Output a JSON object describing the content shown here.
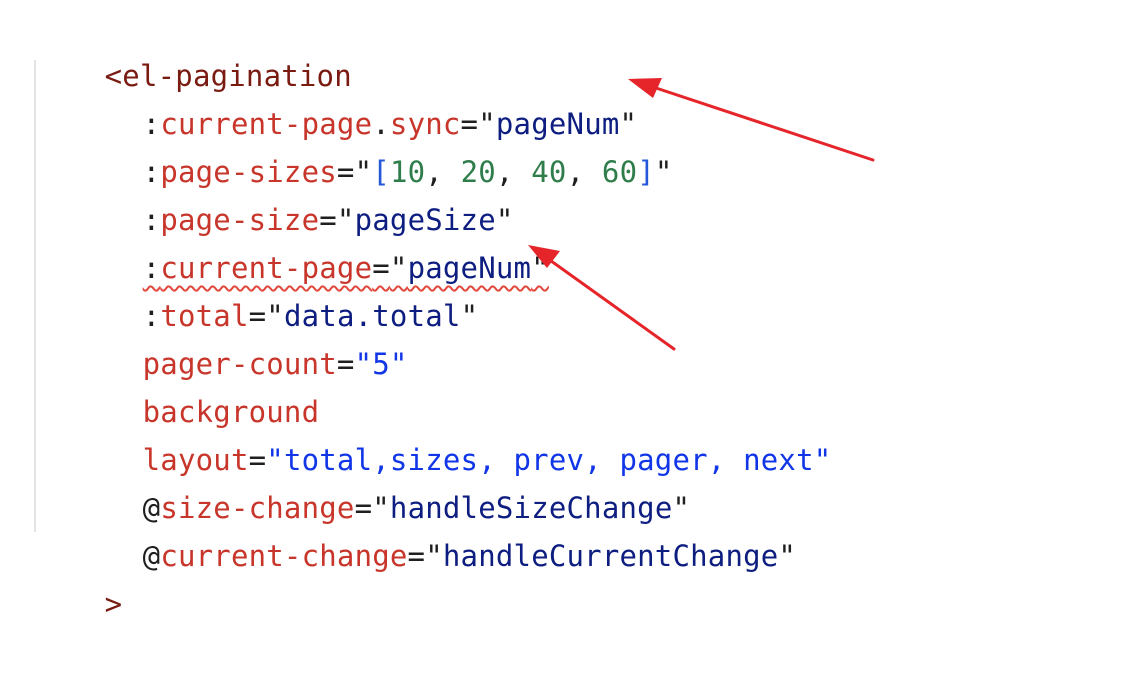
{
  "code": {
    "open_tag": "<el-pagination",
    "close_tag": ">",
    "lines": [
      {
        "prefix": ":",
        "attr": "current-page",
        "mid": ".",
        "attr2": "sync",
        "eq": "=",
        "q1": "\"",
        "value": "pageNum",
        "q2": "\""
      },
      {
        "prefix": ":",
        "attr": "page-sizes",
        "eq": "=",
        "q1": "\"",
        "b1": "[",
        "n1": "10",
        "c1": ", ",
        "n2": "20",
        "c2": ", ",
        "n3": "40",
        "c3": ", ",
        "n4": "60",
        "b2": "]",
        "q2": "\""
      },
      {
        "prefix": ":",
        "attr": "page-size",
        "eq": "=",
        "q1": "\"",
        "value": "pageSize",
        "q2": "\""
      },
      {
        "prefix": ":",
        "attr": "current-page",
        "eq": "=",
        "q1": "\"",
        "value": "pageNum",
        "q2": "\""
      },
      {
        "prefix": ":",
        "attr": "total",
        "eq": "=",
        "q1": "\"",
        "value": "data.total",
        "q2": "\""
      },
      {
        "attr": "pager-count",
        "eq": "=",
        "value": "\"5\""
      },
      {
        "attr": "background"
      },
      {
        "attr": "layout",
        "eq": "=",
        "value": "\"total,sizes, prev, pager, next\""
      },
      {
        "prefix": "@",
        "attr": "size-change",
        "eq": "=",
        "q1": "\"",
        "value": "handleSizeChange",
        "q2": "\""
      },
      {
        "prefix": "@",
        "attr": "current-change",
        "eq": "=",
        "q1": "\"",
        "value": "handleCurrentChange",
        "q2": "\""
      }
    ]
  },
  "colors": {
    "tag": "#7a1b12",
    "attribute": "#c8352a",
    "string": "#0d1d80",
    "number": "#2f7d4a",
    "annotation_arrow": "#e5252a",
    "error_squiggle": "#e1483c"
  }
}
